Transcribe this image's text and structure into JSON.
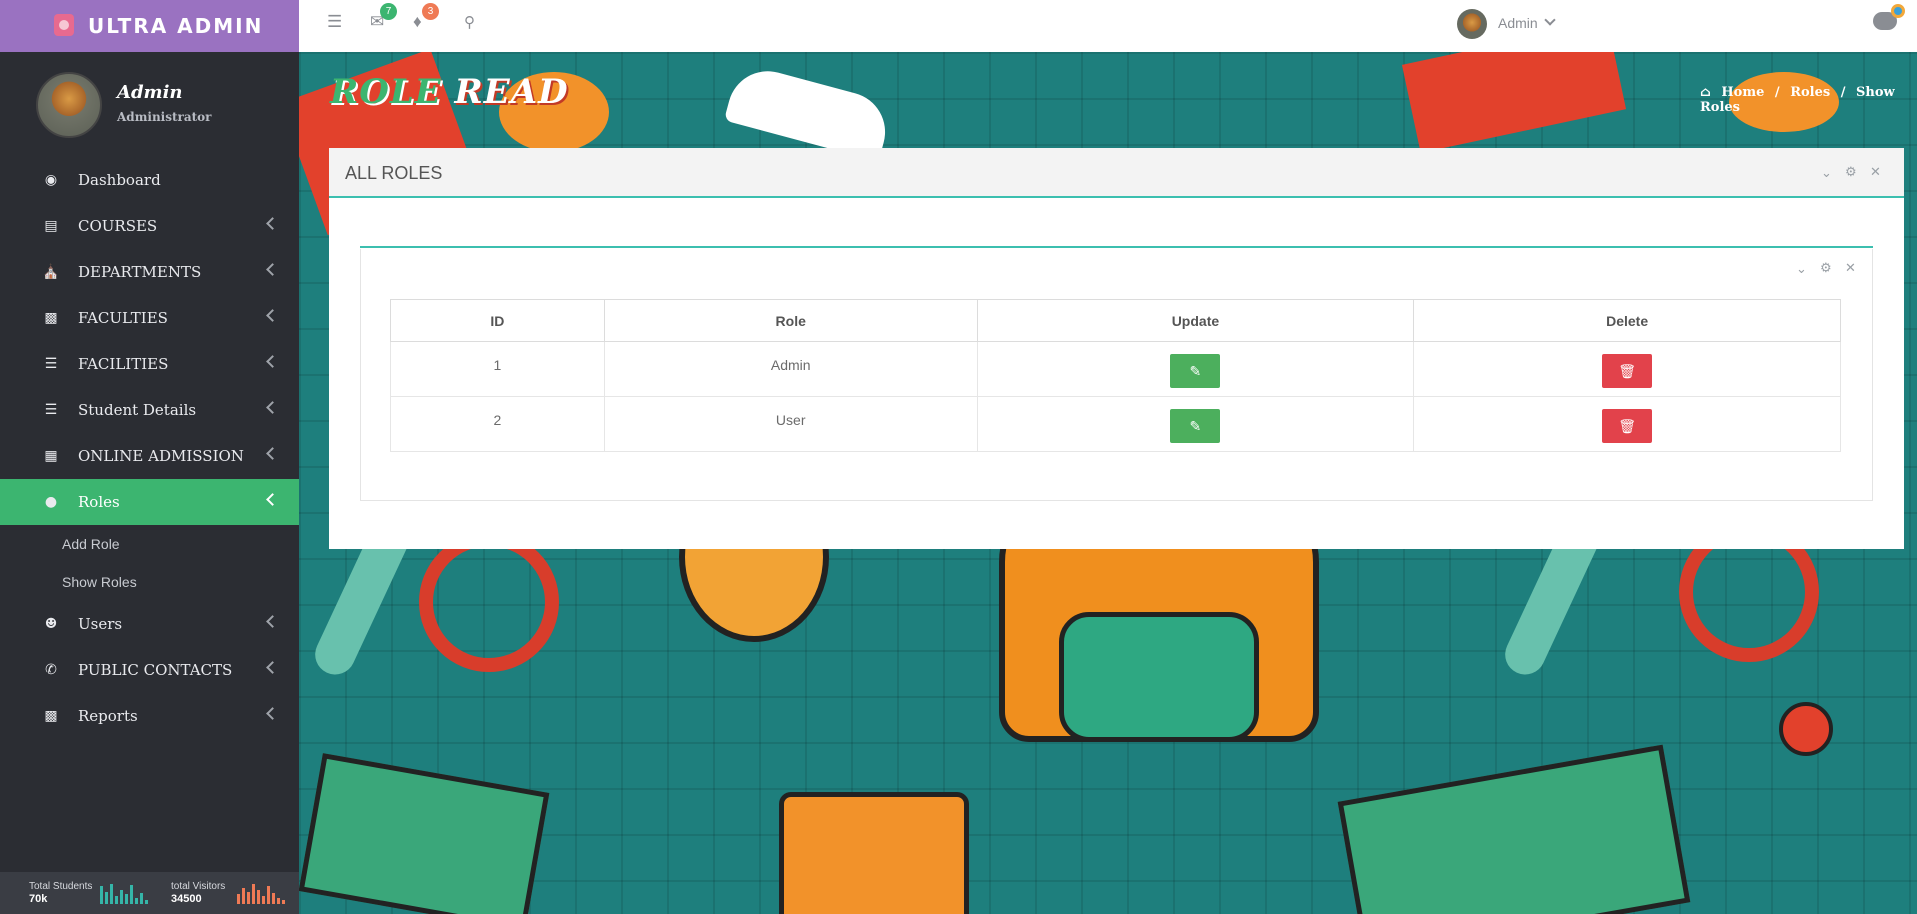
{
  "app": {
    "title": "ULTRA ADMIN"
  },
  "profile": {
    "name": "Admin",
    "role": "Administrator"
  },
  "sidebar": {
    "items": [
      {
        "label": "Dashboard",
        "icon": "palette-icon",
        "has_children": false
      },
      {
        "label": "COURSES",
        "icon": "book-icon",
        "has_children": true
      },
      {
        "label": "DEPARTMENTS",
        "icon": "bank-icon",
        "has_children": true
      },
      {
        "label": "FACULTIES",
        "icon": "id-card-icon",
        "has_children": true
      },
      {
        "label": "FACILITIES",
        "icon": "list-check-icon",
        "has_children": true
      },
      {
        "label": "Student Details",
        "icon": "list-check-icon",
        "has_children": true
      },
      {
        "label": "ONLINE ADMISSION",
        "icon": "id-badge-icon",
        "has_children": true
      },
      {
        "label": "Roles",
        "icon": "user-circle-icon",
        "has_children": true,
        "active": true
      },
      {
        "label": "Users",
        "icon": "users-icon",
        "has_children": true
      },
      {
        "label": "PUBLIC CONTACTS",
        "icon": "phone-icon",
        "has_children": true
      },
      {
        "label": "Reports",
        "icon": "bar-chart-icon",
        "has_children": true
      }
    ],
    "roles_submenu": [
      {
        "label": "Add Role"
      },
      {
        "label": "Show Roles"
      }
    ]
  },
  "stats": [
    {
      "label": "Total Students",
      "value": "70k",
      "color": "#35b5a8"
    },
    {
      "label": "total Visitors",
      "value": "34500",
      "color": "#ef7a55"
    }
  ],
  "topbar": {
    "messages_count": "7",
    "notifications_count": "3",
    "user_name": "Admin",
    "messages_badge_color": "#3cb570",
    "notifications_badge_color": "#ef7a55"
  },
  "page": {
    "title_part1": "ROLE",
    "title_part2": "READ",
    "breadcrumbs": [
      "Home",
      "Roles",
      "Show Roles"
    ]
  },
  "panel": {
    "title": "ALL ROLES",
    "table": {
      "headers": [
        "ID",
        "Role",
        "Update",
        "Delete"
      ],
      "rows": [
        {
          "id": "1",
          "role": "Admin"
        },
        {
          "id": "2",
          "role": "User"
        }
      ]
    }
  },
  "colors": {
    "sidebar_bg": "#2b2d33",
    "logo_bg": "#9a72c1",
    "accent_green": "#3cb570",
    "panel_line": "#3cbfaf",
    "update_button": "#4caf5d",
    "delete_button": "#e2424b"
  }
}
